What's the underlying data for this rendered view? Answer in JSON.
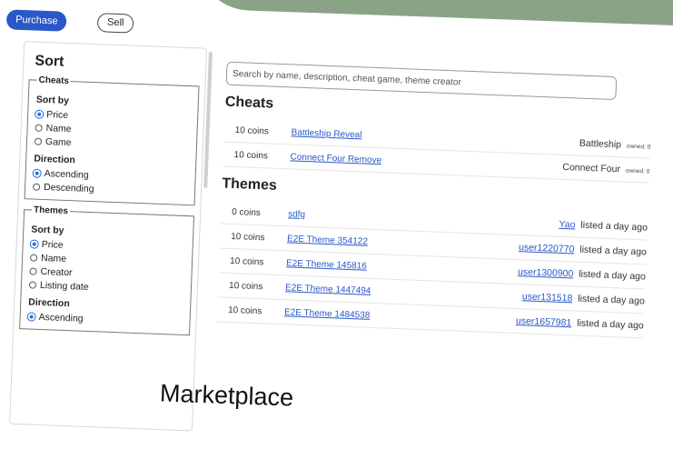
{
  "tabs": {
    "purchase": "Purchase",
    "sell": "Sell"
  },
  "sidebar": {
    "title": "Sort",
    "cheats": {
      "legend": "Cheats",
      "sort_by": "Sort by",
      "options": [
        "Price",
        "Name",
        "Game"
      ],
      "selected": 0,
      "direction": "Direction",
      "dir_options": [
        "Ascending",
        "Descending"
      ],
      "dir_selected": 0
    },
    "themes": {
      "legend": "Themes",
      "sort_by": "Sort by",
      "options": [
        "Price",
        "Name",
        "Creator",
        "Listing date"
      ],
      "selected": 0,
      "direction": "Direction",
      "dir_options": [
        "Ascending"
      ],
      "dir_selected": 0
    }
  },
  "search": {
    "placeholder": "Search by name, description, cheat game, theme creator"
  },
  "cheats": {
    "title": "Cheats",
    "rows": [
      {
        "price": "10 coins",
        "name": "Battleship Reveal",
        "game": "Battleship",
        "owned": "owned: 0"
      },
      {
        "price": "10 coins",
        "name": "Connect Four Remove",
        "game": "Connect Four",
        "owned": "owned: 0"
      }
    ]
  },
  "themes": {
    "title": "Themes",
    "rows": [
      {
        "price": "0 coins",
        "name": "sdfg",
        "creator": "Yao",
        "listed": "listed a day ago"
      },
      {
        "price": "10 coins",
        "name": "E2E Theme 354122",
        "creator": "user1220770",
        "listed": "listed a day ago"
      },
      {
        "price": "10 coins",
        "name": "E2E Theme 145816",
        "creator": "user1300900",
        "listed": "listed a day ago"
      },
      {
        "price": "10 coins",
        "name": "E2E Theme 1447494",
        "creator": "user131518",
        "listed": "listed a day ago"
      },
      {
        "price": "10 coins",
        "name": "E2E Theme 1484538",
        "creator": "user1657981",
        "listed": "listed a day ago"
      }
    ]
  },
  "page_title": "Marketplace",
  "colors": {
    "accent": "#2b58c9",
    "deco": "#8aa387"
  }
}
